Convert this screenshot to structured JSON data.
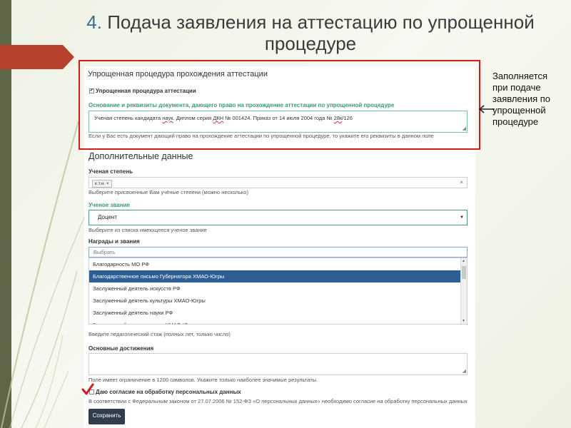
{
  "slide": {
    "title_number": "4.",
    "title_text": "Подача заявления на аттестацию по упрощенной процедуре",
    "side_note": "Заполняется при подаче заявления по упрощенной процедуре"
  },
  "colors": {
    "accent_red": "#d51a1a",
    "banner_red": "#b7412f",
    "label_green": "#3a9a74",
    "select_blue": "#2d5f94",
    "button_dark": "#2f3d4d"
  },
  "form": {
    "simplified_section_title": "Упрощенная процедура прохождения аттестации",
    "simplified_checkbox_label": "Упрощенная процедура аттестации",
    "simplified_checkbox_mark": "✔",
    "basis_label": "Основание и реквизиты документа, дающего право на прохождение аттестации по упрощенной процедуре",
    "basis_value_part1": "Ученая степень кандидата ",
    "basis_value_u1": "наук",
    "basis_value_part2": ". Диплом серия ",
    "basis_value_u2": "ДКН",
    "basis_value_part3": " № 001424. Приказ от 14 июля 2004 года № ",
    "basis_value_u3": "28к",
    "basis_value_part4": "/126",
    "basis_help": "Если у Вас есть документ дающий право на прохождение аттестации по упрощенной процедуре, то укажите его реквизиты в данном поле",
    "additional_title": "Дополнительные данные",
    "degree_label": "Ученая степень",
    "degree_tag": "к.т.н. ×",
    "degree_clear": "×",
    "degree_help": "Выберите присвоенные Вам учёные степени (можно несколько)",
    "rank_label": "Ученое звание",
    "rank_value": "Доцент",
    "rank_caret": "▼",
    "rank_help": "Выберите из списка имеющееся ученое звание",
    "awards_label": "Награды и звания",
    "awards_search_placeholder": "Выбрать",
    "awards_options": [
      "Благодарность МО РФ",
      "Благодарственное письмо Губернатора ХМАО-Югры",
      "Заслуженный деятель искусств РФ",
      "Заслуженный деятель культуры ХМАО-Югры",
      "Заслуженный деятель науки РФ",
      "Заслуженный деятель науки ХМАО-Югры"
    ],
    "awards_selected_index": 1,
    "scroll_up": "▲",
    "scroll_down": "▼",
    "experience_help": "Введите педагогический стаж (полных лет, только число)",
    "achievements_label": "Основные достижения",
    "achievements_help": "Поле имеет ограничение в 1200 символов. Укажите только наиболее значимые результаты.",
    "consent_label": "Даю согласие на обработку персональных данных",
    "consent_help": "В соответствии с Федеральным законом от 27.07.2006 № 152-ФЗ «О персональных данных» необходимо согласие на обработку персональных данных",
    "save_button": "Сохранить",
    "resize_glyph": "◢"
  }
}
